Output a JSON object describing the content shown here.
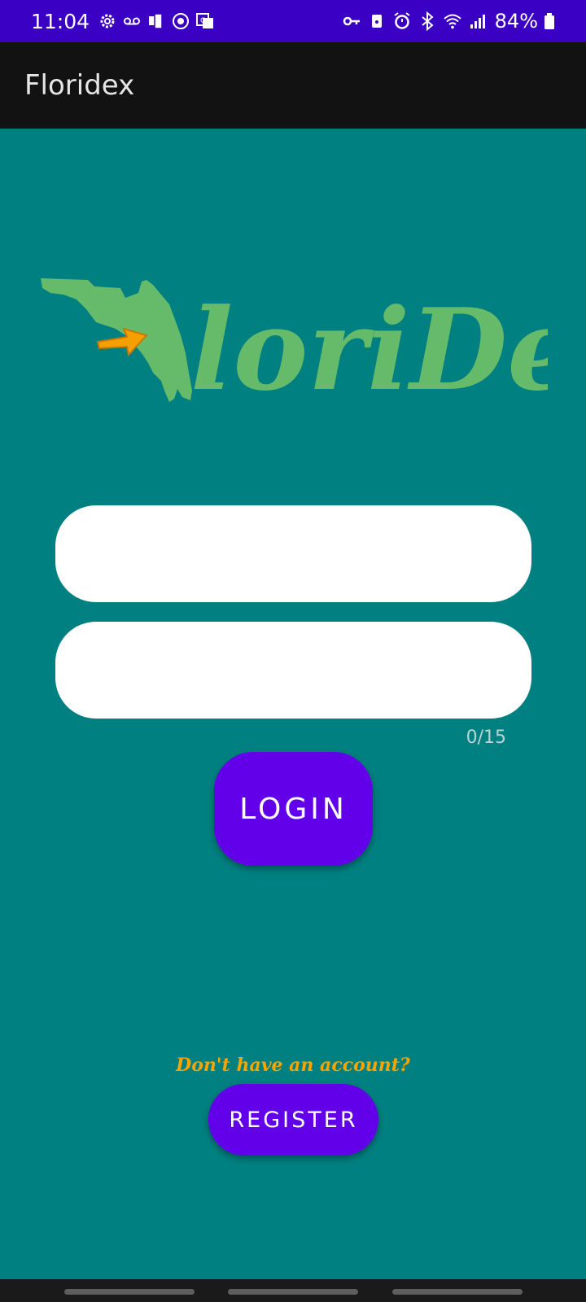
{
  "status_bar": {
    "time": "11:04",
    "battery_percent": "84%",
    "left_icons": [
      "settings-icon",
      "voicemail-icon",
      "phone-transfer-icon",
      "vpn-globe-icon",
      "translate-icon"
    ],
    "right_icons": [
      "key-icon",
      "android-lock-icon",
      "alarm-icon",
      "bluetooth-icon",
      "wifi-icon",
      "cell-signal-icon",
      "battery-icon"
    ],
    "background": "#3a00c4"
  },
  "app_bar": {
    "title": "Floridex"
  },
  "logo": {
    "text": "loriDex",
    "color": "#66bb6a",
    "arrow_color": "#f5a000"
  },
  "form": {
    "username_value": "",
    "password_value": "",
    "password_counter": "0/15",
    "login_label": "LOGIN"
  },
  "register": {
    "prompt": "Don't have an account?",
    "button_label": "REGISTER"
  },
  "colors": {
    "background": "#008080",
    "button": "#6200ea",
    "prompt": "#f5a400"
  }
}
